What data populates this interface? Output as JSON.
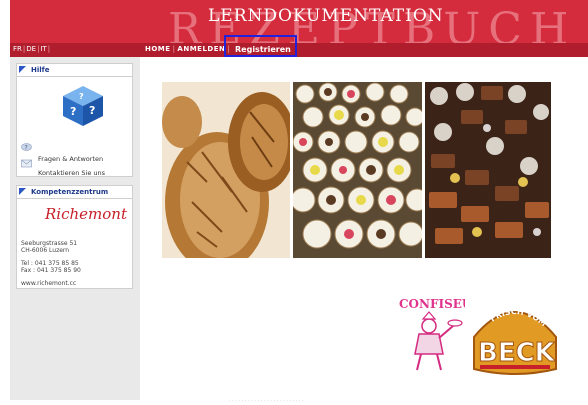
{
  "header": {
    "title": "LERNDOKUMENTATION",
    "watermark": "REZEPTBUCH",
    "background_color": "#d42c3d"
  },
  "languages": [
    "FR",
    "DE",
    "IT"
  ],
  "nav": {
    "home": "HOME",
    "anmelden": "ANMELDEN",
    "registrieren": "Registrieren"
  },
  "sidebar": {
    "hilfe": {
      "title": "Hilfe",
      "icon": "help-cube-icon",
      "links": [
        "Fragen & Antworten",
        "Kontaktieren Sie uns"
      ]
    },
    "kompetenz": {
      "title": "Kompetenzzentrum",
      "logo": "Richemont",
      "address": [
        "Seeburgstrasse 51",
        "CH-6006 Luzern"
      ],
      "tel": "Tel : 041 375 85 85",
      "fax": "Fax : 041 375 85 90",
      "website": "www.richemont.cc"
    }
  },
  "images": [
    "bread-photo",
    "pastries-photo",
    "chocolates-photo"
  ],
  "logos": {
    "confiseur": "CONFISEUR",
    "beck_arc": "FRISCH VOM",
    "beck": "BECK"
  }
}
